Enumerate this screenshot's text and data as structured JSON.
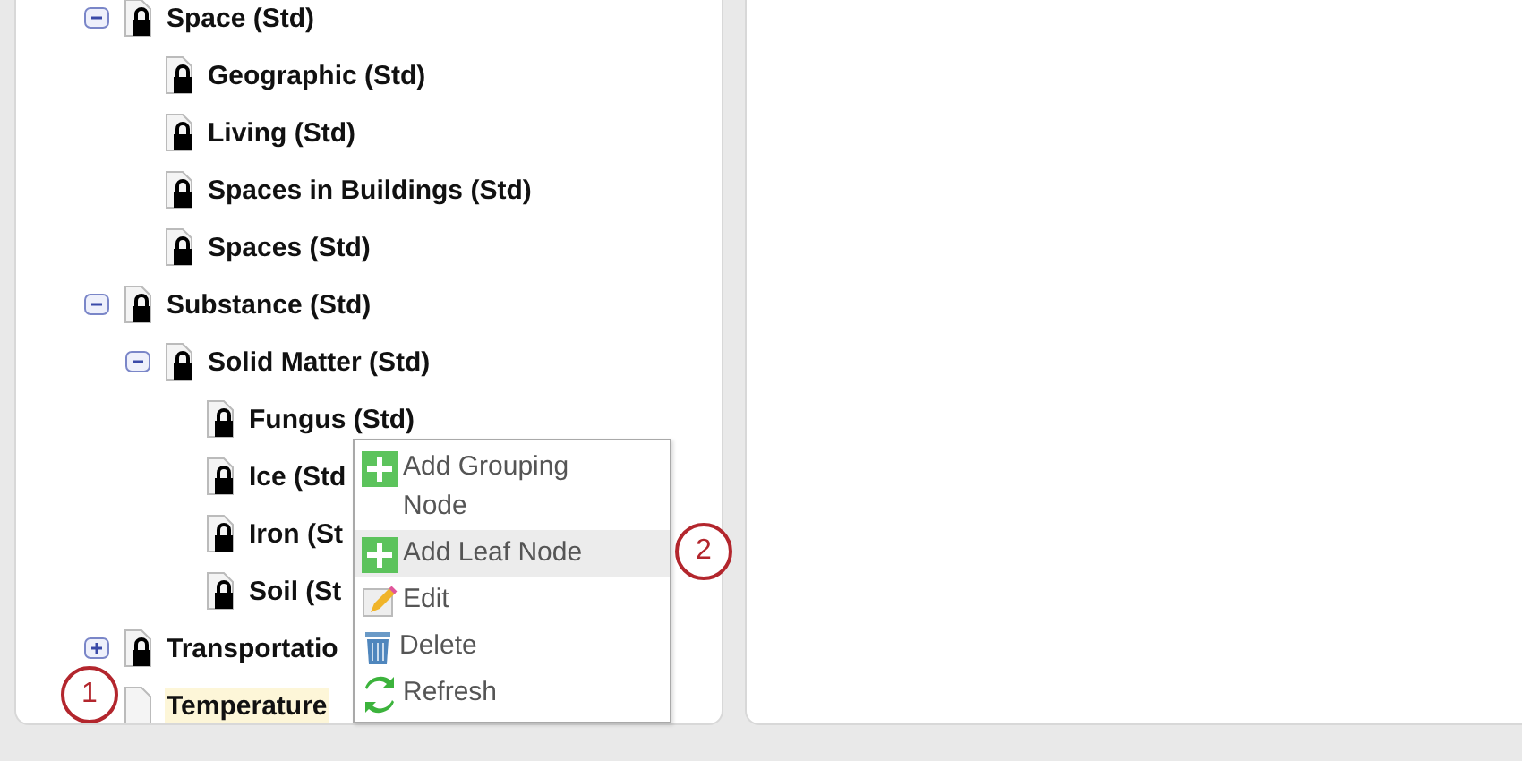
{
  "tree": [
    {
      "label": "Space (Std)",
      "locked": true,
      "expanded": true,
      "selected": false,
      "children": [
        {
          "label": "Geographic (Std)",
          "locked": true,
          "selected": false
        },
        {
          "label": "Living (Std)",
          "locked": true,
          "selected": false
        },
        {
          "label": "Spaces in Buildings (Std)",
          "locked": true,
          "selected": false
        },
        {
          "label": "Spaces (Std)",
          "locked": true,
          "selected": false
        }
      ]
    },
    {
      "label": "Substance (Std)",
      "locked": true,
      "expanded": true,
      "selected": false,
      "children": [
        {
          "label": "Solid Matter (Std)",
          "locked": true,
          "expanded": true,
          "selected": false,
          "children": [
            {
              "label": "Fungus (Std)",
              "locked": true,
              "selected": false
            },
            {
              "label": "Ice (Std",
              "locked": true,
              "selected": false
            },
            {
              "label": "Iron (St",
              "locked": true,
              "selected": false
            },
            {
              "label": "Soil (St",
              "locked": true,
              "selected": false
            }
          ]
        }
      ]
    },
    {
      "label": "Transportatio",
      "locked": true,
      "expanded": false,
      "selected": false
    },
    {
      "label": "Temperature",
      "locked": false,
      "selected": true
    }
  ],
  "context_menu": [
    {
      "kind": "add",
      "label": "Add Grouping Node",
      "hovered": false
    },
    {
      "kind": "add",
      "label": "Add Leaf Node",
      "hovered": true
    },
    {
      "kind": "edit",
      "label": "Edit",
      "hovered": false
    },
    {
      "kind": "delete",
      "label": "Delete",
      "hovered": false
    },
    {
      "kind": "refresh",
      "label": "Refresh",
      "hovered": false
    }
  ],
  "callouts": [
    {
      "label": "1"
    },
    {
      "label": "2"
    }
  ]
}
